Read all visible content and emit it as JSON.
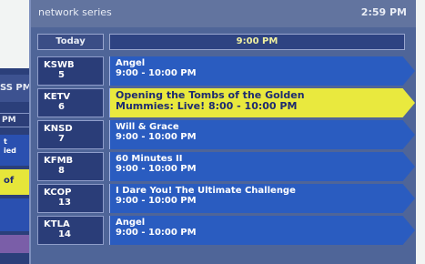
{
  "background_guide": {
    "header_text": "SS PM",
    "time_text": "PM",
    "cell_a_lines": [
      "t",
      "ied"
    ],
    "cell_b_text": "of"
  },
  "guide": {
    "title": "network series",
    "clock": "2:59 PM",
    "today_label": "Today",
    "time_slot": "9:00 PM",
    "rows": [
      {
        "call": "KSWB",
        "num": "5",
        "title": "Angel",
        "time": "9:00 - 10:00 PM",
        "selected": false
      },
      {
        "call": "KETV",
        "num": "6",
        "title": "Opening the Tombs of the Golden",
        "time": "Mummies: Live!  8:00 - 10:00 PM",
        "selected": true
      },
      {
        "call": "KNSD",
        "num": "7",
        "title": "Will & Grace",
        "time": "9:00 - 10:00 PM",
        "selected": false
      },
      {
        "call": "KFMB",
        "num": "8",
        "title": "60 Minutes II",
        "time": "9:00 - 10:00 PM",
        "selected": false
      },
      {
        "call": "KCOP",
        "num": "13",
        "title": "I Dare You! The Ultimate Challenge",
        "time": "9:00 - 10:00 PM",
        "selected": false
      },
      {
        "call": "KTLA",
        "num": "14",
        "title": "Angel",
        "time": "9:00 - 10:00 PM",
        "selected": false
      }
    ]
  },
  "colors": {
    "selected_program": "#e9e93e",
    "program": "#2a5cc0",
    "panel": "#4f6598"
  }
}
